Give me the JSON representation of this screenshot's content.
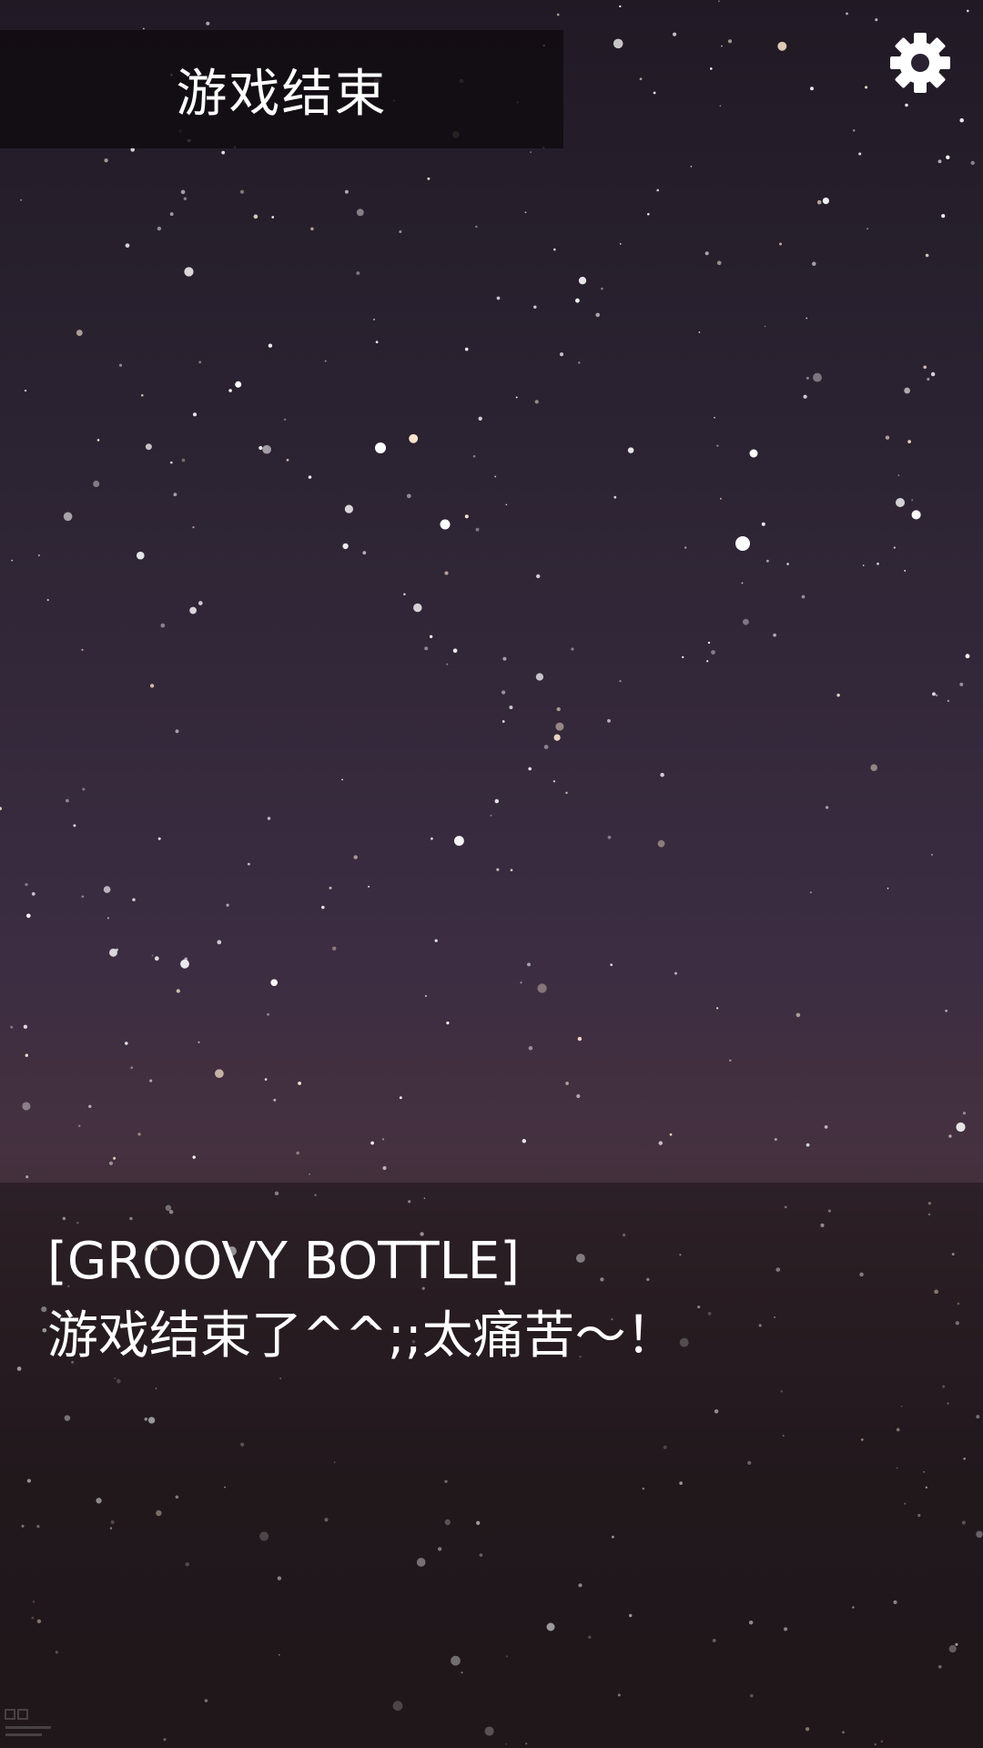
{
  "header": {
    "title": "游戏结束"
  },
  "toolbar": {
    "settings_icon": "gear-icon"
  },
  "dialog": {
    "speaker": "[GROOVY BOTTLE]",
    "text": "游戏结束了^^;;太痛苦～！"
  },
  "colors": {
    "banner_bg": "#100b10",
    "text": "#ffffff",
    "sky_top": "#211a25",
    "sky_horizon": "#45313f",
    "ground": "#2b1f24"
  }
}
